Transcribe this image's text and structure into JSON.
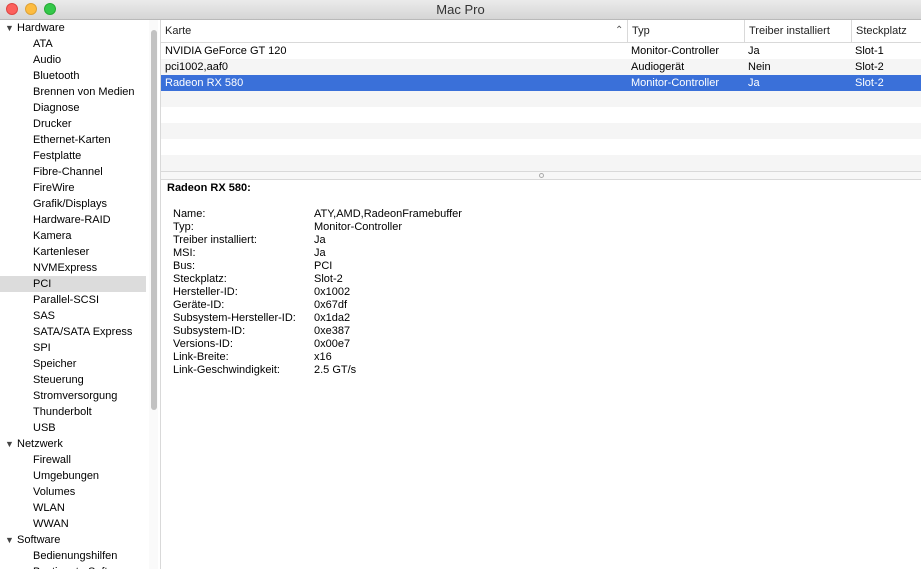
{
  "window": {
    "title": "Mac Pro"
  },
  "sidebar": {
    "rows": [
      {
        "type": "category",
        "label": "Hardware"
      },
      {
        "type": "item",
        "label": "ATA"
      },
      {
        "type": "item",
        "label": "Audio"
      },
      {
        "type": "item",
        "label": "Bluetooth"
      },
      {
        "type": "item",
        "label": "Brennen von Medien"
      },
      {
        "type": "item",
        "label": "Diagnose"
      },
      {
        "type": "item",
        "label": "Drucker"
      },
      {
        "type": "item",
        "label": "Ethernet-Karten"
      },
      {
        "type": "item",
        "label": "Festplatte"
      },
      {
        "type": "item",
        "label": "Fibre-Channel"
      },
      {
        "type": "item",
        "label": "FireWire"
      },
      {
        "type": "item",
        "label": "Grafik/Displays"
      },
      {
        "type": "item",
        "label": "Hardware-RAID"
      },
      {
        "type": "item",
        "label": "Kamera"
      },
      {
        "type": "item",
        "label": "Kartenleser"
      },
      {
        "type": "item",
        "label": "NVMExpress"
      },
      {
        "type": "item",
        "label": "PCI",
        "selected": true
      },
      {
        "type": "item",
        "label": "Parallel-SCSI"
      },
      {
        "type": "item",
        "label": "SAS"
      },
      {
        "type": "item",
        "label": "SATA/SATA Express"
      },
      {
        "type": "item",
        "label": "SPI"
      },
      {
        "type": "item",
        "label": "Speicher"
      },
      {
        "type": "item",
        "label": "Steuerung"
      },
      {
        "type": "item",
        "label": "Stromversorgung"
      },
      {
        "type": "item",
        "label": "Thunderbolt"
      },
      {
        "type": "item",
        "label": "USB"
      },
      {
        "type": "category",
        "label": "Netzwerk"
      },
      {
        "type": "item",
        "label": "Firewall"
      },
      {
        "type": "item",
        "label": "Umgebungen"
      },
      {
        "type": "item",
        "label": "Volumes"
      },
      {
        "type": "item",
        "label": "WLAN"
      },
      {
        "type": "item",
        "label": "WWAN"
      },
      {
        "type": "category",
        "label": "Software"
      },
      {
        "type": "item",
        "label": "Bedienungshilfen"
      },
      {
        "type": "item",
        "label": "Bestimmte Software"
      }
    ]
  },
  "table": {
    "columns": [
      "Karte",
      "Typ",
      "Treiber installiert",
      "Steckplatz"
    ],
    "rows": [
      [
        "NVIDIA GeForce GT 120",
        "Monitor-Controller",
        "Ja",
        "Slot-1"
      ],
      [
        "pci1002,aaf0",
        "Audiogerät",
        "Nein",
        "Slot-2"
      ],
      [
        "Radeon RX 580",
        "Monitor-Controller",
        "Ja",
        "Slot-2"
      ]
    ],
    "selected_index": 2
  },
  "detail": {
    "title": "Radeon RX 580:",
    "properties": [
      {
        "key": "Name:",
        "value": "ATY,AMD,RadeonFramebuffer"
      },
      {
        "key": "Typ:",
        "value": "Monitor-Controller"
      },
      {
        "key": "Treiber installiert:",
        "value": "Ja"
      },
      {
        "key": "MSI:",
        "value": "Ja"
      },
      {
        "key": "Bus:",
        "value": "PCI"
      },
      {
        "key": "Steckplatz:",
        "value": "Slot-2"
      },
      {
        "key": "Hersteller-ID:",
        "value": "0x1002"
      },
      {
        "key": "Geräte-ID:",
        "value": "0x67df"
      },
      {
        "key": "Subsystem-Hersteller-ID:",
        "value": "0x1da2"
      },
      {
        "key": "Subsystem-ID:",
        "value": "0xe387"
      },
      {
        "key": "Versions-ID:",
        "value": "0x00e7"
      },
      {
        "key": "Link-Breite:",
        "value": "x16"
      },
      {
        "key": "Link-Geschwindigkeit:",
        "value": "2.5 GT/s"
      }
    ]
  },
  "icons": {
    "disclosure": "disclosure-triangle-icon",
    "sort": "sort-ascending-icon",
    "splitter": "splitter-handle-icon"
  },
  "colors": {
    "selection": "#3a70d9",
    "sidebar_selection": "#dcdcdc",
    "close": "#fc605c",
    "minimize": "#fdbc40",
    "zoom": "#34c84a"
  }
}
